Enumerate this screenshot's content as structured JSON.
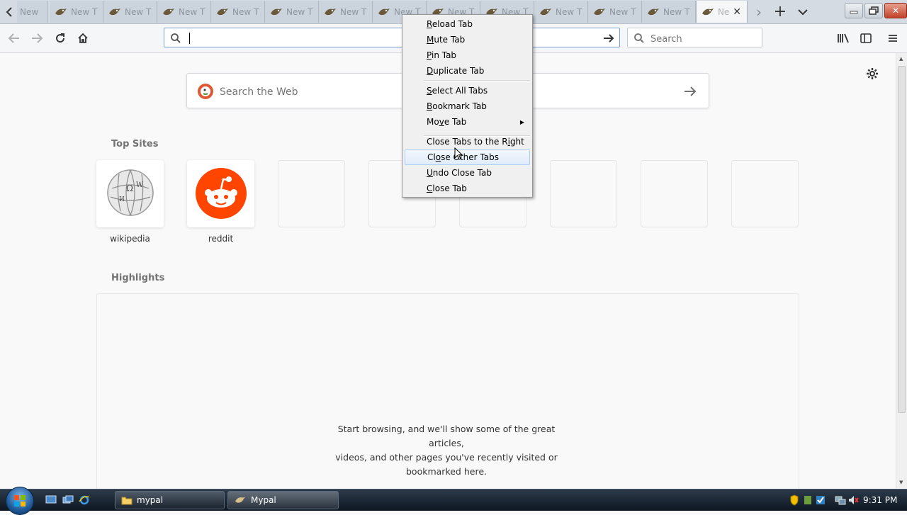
{
  "tabs": {
    "scroll_left_icon": "chevron-left-icon",
    "items": [
      {
        "label": "New T",
        "favicon": "mypal-icon"
      },
      {
        "label": "New T",
        "favicon": "mypal-icon"
      },
      {
        "label": "New T",
        "favicon": "mypal-icon"
      },
      {
        "label": "New T",
        "favicon": "mypal-icon"
      },
      {
        "label": "New T",
        "favicon": "mypal-icon"
      },
      {
        "label": "New T",
        "favicon": "mypal-icon"
      },
      {
        "label": "New T",
        "favicon": "mypal-icon"
      },
      {
        "label": "New T",
        "favicon": "mypal-icon"
      },
      {
        "label": "New T",
        "favicon": "mypal-icon"
      },
      {
        "label": "New T",
        "favicon": "mypal-icon"
      },
      {
        "label": "New T",
        "favicon": "mypal-icon"
      },
      {
        "label": "New T",
        "favicon": "mypal-icon"
      }
    ],
    "first_partial_label": "New",
    "active_label": "Ne",
    "close_glyph": "✕",
    "new_tab_glyph": "+",
    "scroll_right_glyph": "›",
    "list_all_glyph": "⌄"
  },
  "window_controls": {
    "minimize": "—",
    "maximize": "❐",
    "close": "✕"
  },
  "navbar": {
    "url_value": "",
    "search_placeholder": "Search"
  },
  "content": {
    "web_search_placeholder": "Search the Web",
    "top_sites_title": "Top Sites",
    "top_sites": [
      {
        "label": "wikipedia",
        "icon": "wikipedia-logo"
      },
      {
        "label": "reddit",
        "icon": "reddit-logo"
      },
      {
        "label": ""
      },
      {
        "label": ""
      },
      {
        "label": ""
      },
      {
        "label": ""
      },
      {
        "label": ""
      },
      {
        "label": ""
      }
    ],
    "highlights_title": "Highlights",
    "empty_message_line1": "Start browsing, and we'll show some of the great articles,",
    "empty_message_line2": "videos, and other pages you've recently visited or",
    "empty_message_line3": "bookmarked here."
  },
  "context_menu": {
    "items": [
      {
        "label": "Reload Tab",
        "accel": "R"
      },
      {
        "label": "Mute Tab",
        "accel": "M"
      },
      {
        "label": "Pin Tab",
        "accel": "P"
      },
      {
        "label": "Duplicate Tab",
        "accel": "D"
      },
      {
        "label": "Select All Tabs",
        "accel": "S"
      },
      {
        "label": "Bookmark Tab",
        "accel": "B"
      },
      {
        "label": "Move Tab",
        "accel": "v",
        "submenu": true
      },
      {
        "label": "Close Tabs to the Right",
        "accel": "i"
      },
      {
        "label": "Close Other Tabs",
        "accel": "o",
        "highlighted": true
      },
      {
        "label": "Undo Close Tab",
        "accel": "U"
      },
      {
        "label": "Close Tab",
        "accel": "C"
      }
    ]
  },
  "taskbar": {
    "start_icon": "windows-start-icon",
    "quick_launch": [
      "show-desktop-icon",
      "switch-windows-icon",
      "internet-explorer-icon"
    ],
    "buttons": [
      {
        "label": "mypal",
        "icon": "folder-icon"
      },
      {
        "label": "Mypal",
        "icon": "mypal-icon"
      }
    ],
    "clock": "9:31 PM"
  },
  "colors": {
    "accent": "#0a84ff",
    "reddit": "#ff4500",
    "tabstrip": "#d4dbe3",
    "taskbar": "#1b2632"
  }
}
